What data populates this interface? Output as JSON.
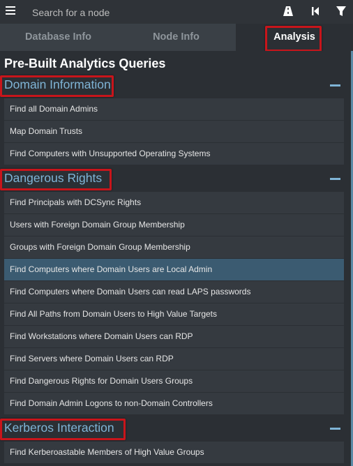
{
  "search": {
    "placeholder": "Search for a node"
  },
  "toolbar": {
    "icons": [
      "hamburger-menu-icon",
      "pathfinding-road-icon",
      "back-icon",
      "filter-icon"
    ]
  },
  "tabs": [
    {
      "label": "Database Info"
    },
    {
      "label": "Node Info"
    },
    {
      "label": "Analysis",
      "active": true
    }
  ],
  "panel": {
    "title": "Pre-Built Analytics Queries",
    "sections": [
      {
        "title": "Domain Information",
        "items": [
          "Find all Domain Admins",
          "Map Domain Trusts",
          "Find Computers with Unsupported Operating Systems"
        ]
      },
      {
        "title": "Dangerous Rights",
        "items": [
          "Find Principals with DCSync Rights",
          "Users with Foreign Domain Group Membership",
          "Groups with Foreign Domain Group Membership",
          "Find Computers where Domain Users are Local Admin",
          "Find Computers where Domain Users can read LAPS passwords",
          "Find All Paths from Domain Users to High Value Targets",
          "Find Workstations where Domain Users can RDP",
          "Find Servers where Domain Users can RDP",
          "Find Dangerous Rights for Domain Users Groups",
          "Find Domain Admin Logons to non-Domain Controllers"
        ]
      },
      {
        "title": "Kerberos Interaction",
        "items": [
          "Find Kerberoastable Members of High Value Groups"
        ]
      }
    ]
  },
  "colors": {
    "background": "#2b2f34",
    "item_background": "#353a40",
    "item_selected": "#3b5b71",
    "section_title": "#7fb4d6",
    "highlight_box": "#c8151b"
  }
}
